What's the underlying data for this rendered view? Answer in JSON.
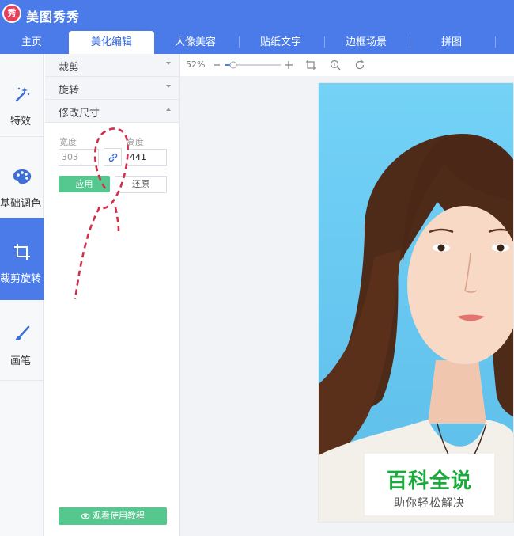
{
  "app": {
    "title": "美图秀秀",
    "logo_text": "秀"
  },
  "tabs": [
    {
      "label": "主页"
    },
    {
      "label": "美化编辑"
    },
    {
      "label": "人像美容"
    },
    {
      "label": "贴纸文字"
    },
    {
      "label": "边框场景"
    },
    {
      "label": "拼图"
    }
  ],
  "sidebar": {
    "items": [
      {
        "label": "特效",
        "icon": "magic-wand-icon"
      },
      {
        "label": "基础调色",
        "icon": "palette-icon"
      },
      {
        "label": "裁剪旋转",
        "icon": "crop-icon",
        "active": true
      },
      {
        "label": "画笔",
        "icon": "brush-icon"
      }
    ]
  },
  "panel": {
    "sections": [
      {
        "label": "裁剪"
      },
      {
        "label": "旋转"
      },
      {
        "label": "修改尺寸"
      }
    ],
    "resize": {
      "width_label": "宽度",
      "width_value": "303",
      "height_label": "高度",
      "height_value": "441",
      "apply_label": "应用",
      "reset_label": "还原"
    },
    "tutorial_label": "观看使用教程"
  },
  "toolbar": {
    "zoom": "52%"
  },
  "watermark": {
    "title": "百科全说",
    "subtitle": "助你轻松解决"
  },
  "colors": {
    "brand_blue": "#4a7be8",
    "green_button": "#55c88f",
    "annotation_red": "#d0304a",
    "photo_background": "#5fc4f2",
    "watermark_green": "#1aaa3c"
  }
}
